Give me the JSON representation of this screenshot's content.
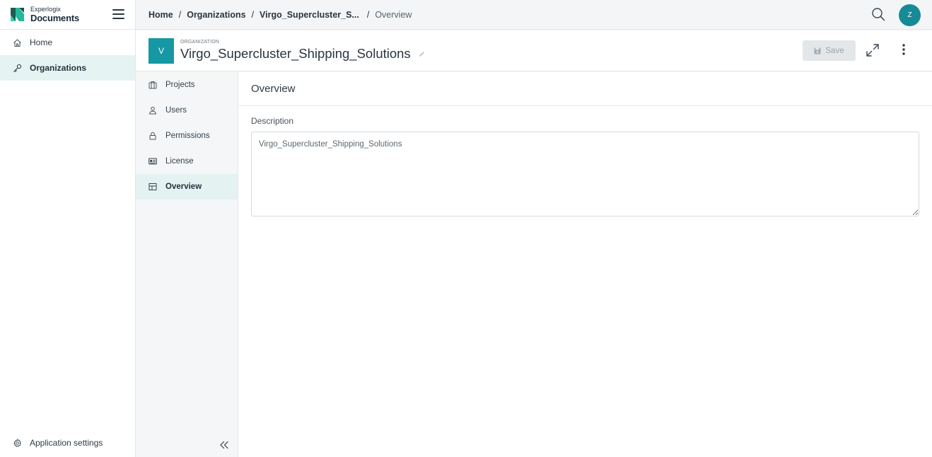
{
  "brand": {
    "small": "Experlogix",
    "big": "Documents"
  },
  "sidebar": {
    "items": [
      {
        "label": "Home",
        "icon": "home-icon"
      },
      {
        "label": "Organizations",
        "icon": "key-icon",
        "active": true
      }
    ],
    "footer": {
      "label": "Application settings",
      "icon": "gear-icon"
    }
  },
  "breadcrumb": [
    {
      "label": "Home"
    },
    {
      "label": "Organizations"
    },
    {
      "label": "Virgo_Supercluster_S..."
    },
    {
      "label": "Overview",
      "current": true
    }
  ],
  "user": {
    "initial": "Z"
  },
  "header": {
    "badge": "V",
    "kicker": "ORGANIZATION",
    "title": "Virgo_Supercluster_Shipping_Solutions",
    "save_label": "Save"
  },
  "subnav": {
    "items": [
      {
        "label": "Projects",
        "icon": "briefcase-icon"
      },
      {
        "label": "Users",
        "icon": "user-icon"
      },
      {
        "label": "Permissions",
        "icon": "lock-icon"
      },
      {
        "label": "License",
        "icon": "id-card-icon"
      },
      {
        "label": "Overview",
        "icon": "grid-icon",
        "active": true
      }
    ]
  },
  "main": {
    "heading": "Overview",
    "description_label": "Description",
    "description_value": "Virgo_Supercluster_Shipping_Solutions"
  },
  "colors": {
    "accent": "#1598a4",
    "avatar": "#168a96",
    "active_bg": "#e6f3f3"
  }
}
